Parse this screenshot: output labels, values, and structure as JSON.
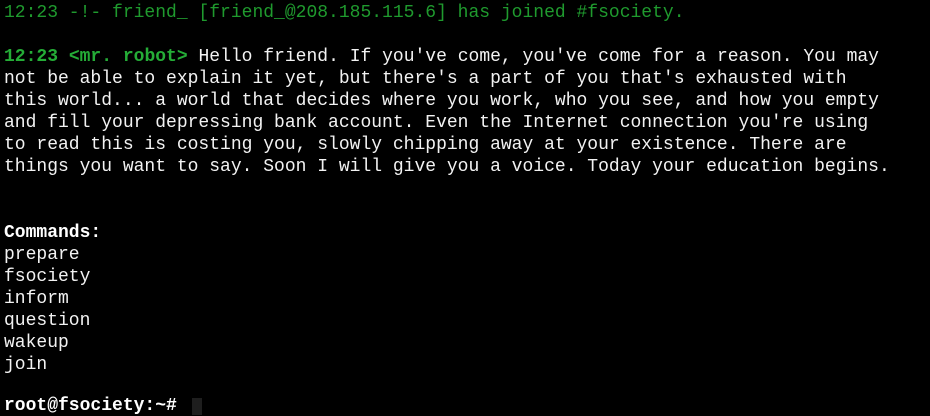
{
  "join_line": "12:23 -!- friend_ [friend_@208.185.115.6] has joined #fsociety.",
  "message": {
    "time": "12:23",
    "nick": "<mr. robot>",
    "lines": [
      "Hello friend. If you've come, you've come for a reason. You may",
      "not be able to explain it yet, but there's a part of you that's exhausted with",
      "this world... a world that decides where you work, who you see, and how you empty",
      "and fill your depressing bank account. Even the Internet connection you're using",
      "to read this is costing you, slowly chipping away at your existence. There are",
      "things you want to say. Soon I will give you a voice. Today your education begins."
    ]
  },
  "commands_header": "Commands:",
  "commands": [
    "prepare",
    "fsociety",
    "inform",
    "question",
    "wakeup",
    "join"
  ],
  "prompt": "root@fsociety:~#",
  "colors": {
    "green": "#1f9a2e",
    "bold_green": "#25ad37",
    "text": "#f2f2f2",
    "background": "#000000"
  }
}
